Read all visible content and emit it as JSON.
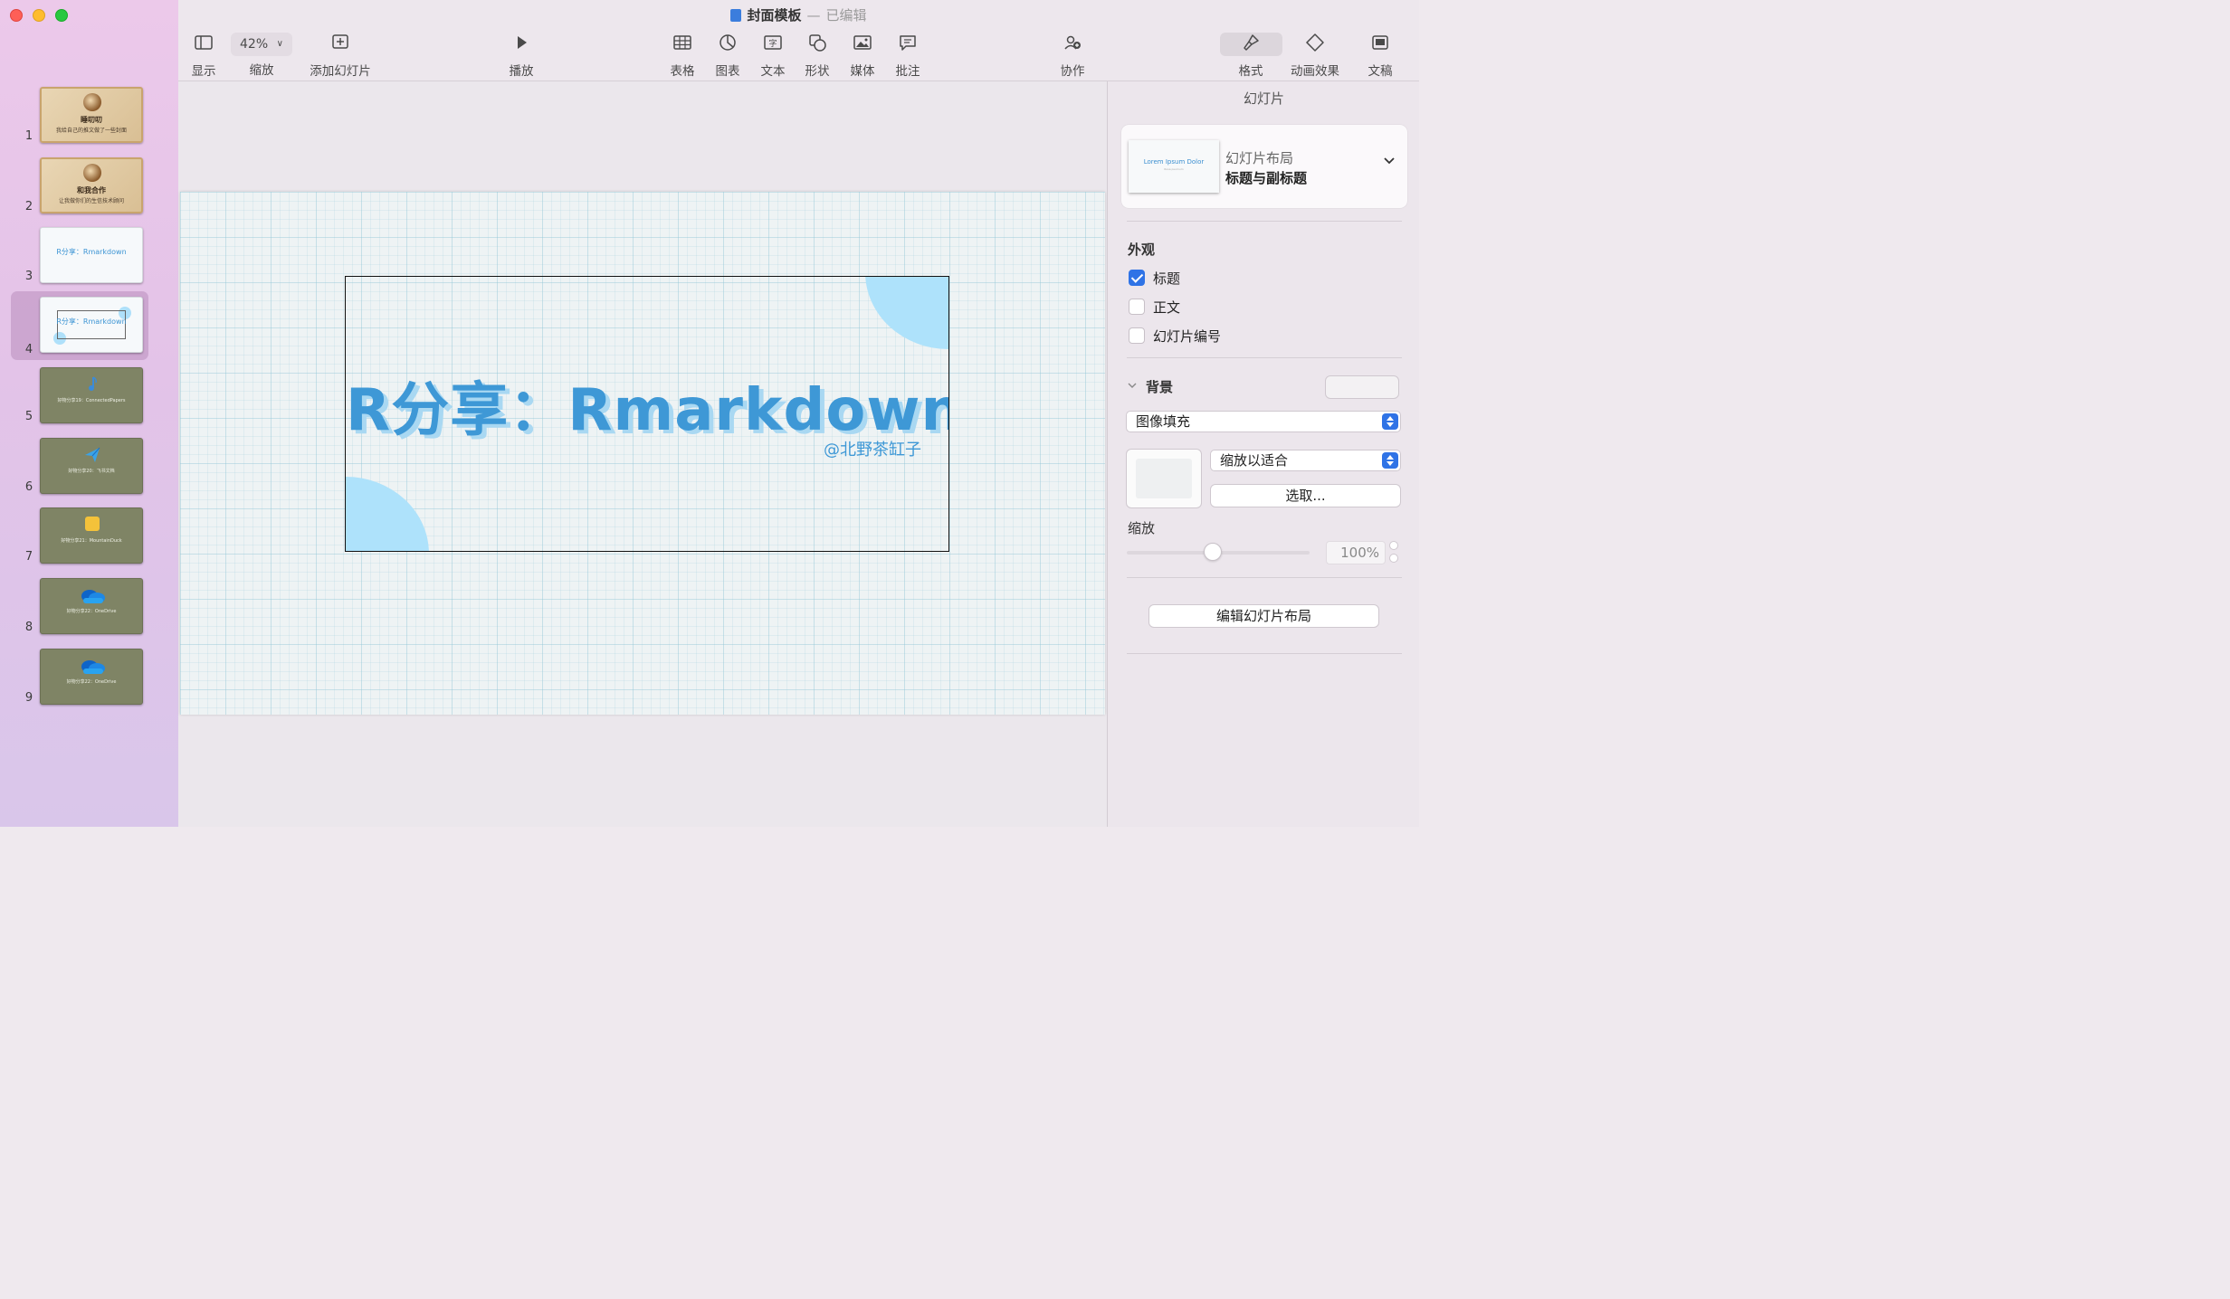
{
  "window": {
    "title": "封面模板",
    "status": "已编辑"
  },
  "toolbar": {
    "view_label": "显示",
    "zoom_value": "42%",
    "zoom_label": "缩放",
    "add_slide_label": "添加幻灯片",
    "play_label": "播放",
    "table_label": "表格",
    "chart_label": "图表",
    "text_label": "文本",
    "shape_label": "形状",
    "media_label": "媒体",
    "comment_label": "批注",
    "collaborate_label": "协作",
    "format_label": "格式",
    "animate_label": "动画效果",
    "document_label": "文稿"
  },
  "slides": [
    {
      "number": "1",
      "style": "beige",
      "title": "睡叨叨",
      "subtitle": "我给自己的推文做了一些封面"
    },
    {
      "number": "2",
      "style": "beige",
      "title": "和我合作",
      "subtitle": "让我做你们的生信技术顾问"
    },
    {
      "number": "3",
      "style": "white",
      "title": "R分享：Rmarkdown"
    },
    {
      "number": "4",
      "style": "white-framed",
      "title": "R分享：Rmarkdown",
      "selected": true
    },
    {
      "number": "5",
      "style": "olive",
      "icon": "music-note-icon",
      "title": "好物分享19：ConnectedPapers"
    },
    {
      "number": "6",
      "style": "olive",
      "icon": "paper-plane-icon",
      "title": "好物分享20：飞书文档"
    },
    {
      "number": "7",
      "style": "olive",
      "icon": "mountain-duck-icon",
      "title": "好物分享21：MountainDuck"
    },
    {
      "number": "8",
      "style": "olive",
      "icon": "onedrive-cloud-icon",
      "title": "好物分享22：OneDrive"
    },
    {
      "number": "9",
      "style": "olive",
      "icon": "onedrive-cloud-icon",
      "title": "好物分享22：OneDrive"
    }
  ],
  "canvas": {
    "title": "R分享：Rmarkdown",
    "subtitle": "@北野茶缸子"
  },
  "inspector": {
    "header": "幻灯片",
    "layout_label": "幻灯片布局",
    "layout_value": "标题与副标题",
    "layout_thumb_title": "Lorem Ipsum Dolor",
    "layout_thumb_subtitle": "Rosa psumum",
    "appearance_heading": "外观",
    "checkboxes": [
      {
        "label": "标题",
        "checked": true
      },
      {
        "label": "正文",
        "checked": false
      },
      {
        "label": "幻灯片编号",
        "checked": false
      }
    ],
    "background_heading": "背景",
    "fill_type": "图像填充",
    "scale_mode": "缩放以适合",
    "choose_button": "选取...",
    "scale_heading": "缩放",
    "scale_value": "100%",
    "scale_fraction": 1.0,
    "edit_layout_button": "编辑幻灯片布局"
  },
  "colors": {
    "accent_blue": "#3e98d6",
    "highlight_circle": "#aee2fb",
    "checkbox_blue": "#2f73e6"
  }
}
